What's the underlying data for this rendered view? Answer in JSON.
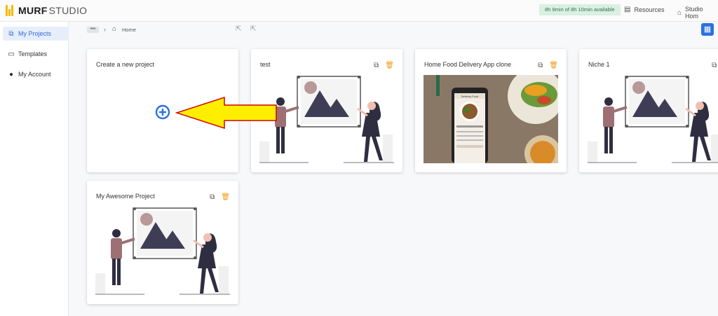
{
  "app": {
    "brand_bold": "MURF",
    "brand_light": "STUDIO"
  },
  "header": {
    "usage": "8h 9min of 8h 10min available",
    "resources_label": "Resources",
    "studio_label": "Studio Hom"
  },
  "sidebar": {
    "items": [
      {
        "label": "My Projects",
        "icon": "projects-icon",
        "active": true
      },
      {
        "label": "Templates",
        "icon": "template-icon",
        "active": false
      },
      {
        "label": "My Account",
        "icon": "user-icon",
        "active": false
      }
    ]
  },
  "breadcrumb": {
    "dots": "•••",
    "home": "Home"
  },
  "projects": {
    "new_project_label": "Create a new project",
    "items": [
      {
        "title": "test",
        "thumbnail": "placeholder-illustration"
      },
      {
        "title": "Home Food Delivery App clone",
        "thumbnail": "food-photo",
        "phone_header": "Delivery Food"
      },
      {
        "title": "Niche 1",
        "thumbnail": "placeholder-illustration"
      },
      {
        "title": "My Awesome Project",
        "thumbnail": "placeholder-illustration"
      }
    ]
  },
  "colors": {
    "accent": "#2a72e0",
    "logo": "#f6b800",
    "trash": "#ef9a14",
    "usage_bg": "#d9f0e2",
    "arrow_fill": "#ffee00",
    "arrow_stroke": "#d40000"
  }
}
